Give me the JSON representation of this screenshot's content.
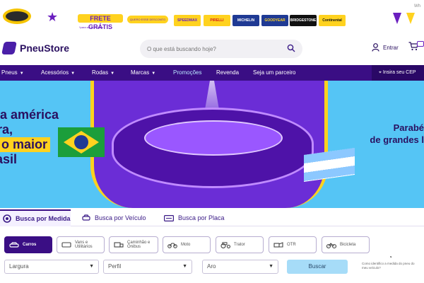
{
  "promo": {
    "frete": "FRETE GRÁTIS",
    "frete_sub": "*para sul e sudeste",
    "desconto": "QUERO ESSE DESCONTO",
    "brands": [
      {
        "label": "SPEEDMAX",
        "bg": "#ffd21f",
        "fg": "#6a1fbf"
      },
      {
        "label": "PIRELLI",
        "bg": "#ffd21f",
        "fg": "#d41c1c"
      },
      {
        "label": "MICHELIN",
        "bg": "#1f3a94",
        "fg": "#ffffff"
      },
      {
        "label": "GOODYEAR",
        "bg": "#1f3a94",
        "fg": "#ffd21f"
      },
      {
        "label": "BRIDGESTONE",
        "bg": "#111111",
        "fg": "#ffffff"
      },
      {
        "label": "Continental",
        "bg": "#ffd21f",
        "fg": "#111111"
      }
    ],
    "whatsapp": "Wh"
  },
  "header": {
    "logo": "PneuStore",
    "search_placeholder": "O que está buscando hoje?",
    "entrar": "Entrar"
  },
  "nav": {
    "items": [
      {
        "label": "Pneus",
        "chevron": true
      },
      {
        "label": "Acessórios",
        "chevron": true
      },
      {
        "label": "Rodas",
        "chevron": true
      },
      {
        "label": "Marcas",
        "chevron": true
      },
      {
        "label": "Promoções",
        "chevron": false,
        "highlight": true
      },
      {
        "label": "Revenda",
        "chevron": false
      },
      {
        "label": "Seja um parceiro",
        "chevron": false
      }
    ],
    "cep": "Insira seu CEP"
  },
  "banner": {
    "left_lines": [
      "a américa",
      "ra,",
      "o maior",
      "asil"
    ],
    "right_lines": [
      "Parabé",
      "de grandes l"
    ]
  },
  "search_tabs": [
    "Busca por Medida",
    "Busca por Veículo",
    "Busca por Placa"
  ],
  "vehicle_types": [
    {
      "label": "Carros",
      "active": true,
      "icon": "car-icon"
    },
    {
      "label": "Vans e Utilitários",
      "active": false,
      "icon": "van-icon"
    },
    {
      "label": "Caminhão e Ônibus",
      "active": false,
      "icon": "truck-icon"
    },
    {
      "label": "Moto",
      "active": false,
      "icon": "motorcycle-icon"
    },
    {
      "label": "Trator",
      "active": false,
      "icon": "tractor-icon"
    },
    {
      "label": "OTR",
      "active": false,
      "icon": "otr-icon"
    },
    {
      "label": "Bicicleta",
      "active": false,
      "icon": "bicycle-icon"
    }
  ],
  "filters": {
    "largura": "Largura",
    "perfil": "Perfil",
    "aro": "Aro",
    "buscar": "Buscar",
    "help": "Como identifico a medida do pneu do meu veículo?"
  },
  "colors": {
    "brand_purple": "#3a0e84",
    "banner_blue": "#55c5f5",
    "accent_yellow": "#ffd21f"
  }
}
